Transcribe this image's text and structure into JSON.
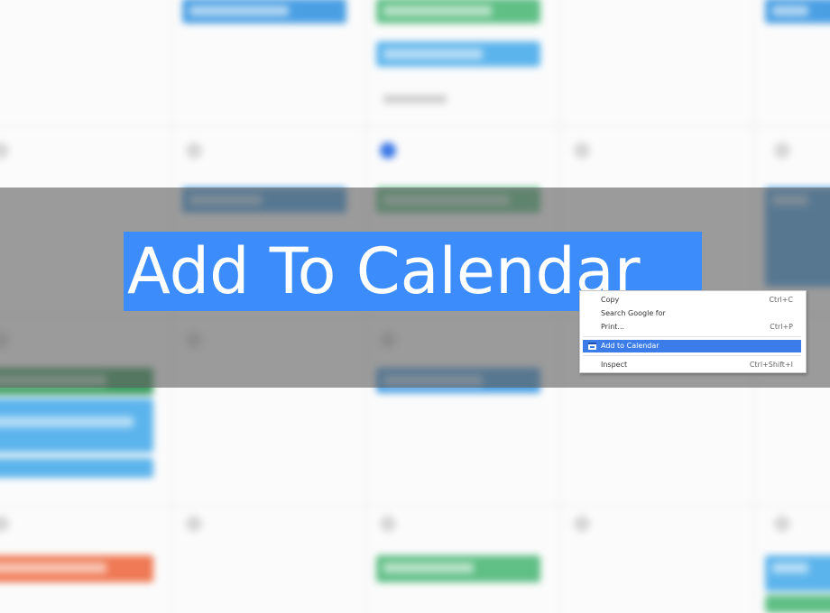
{
  "title": {
    "text": "Add To Calendar",
    "highlight_color": "#3c8dfb"
  },
  "context_menu": {
    "items": [
      {
        "label": "Copy",
        "shortcut": "Ctrl+C"
      },
      {
        "label": "Search Google for",
        "shortcut": ""
      },
      {
        "label": "Print...",
        "shortcut": "Ctrl+P"
      },
      {
        "label": "Add to Calendar",
        "shortcut": "",
        "icon": "calendar-icon",
        "highlighted": true
      },
      {
        "label": "Inspect",
        "shortcut": "Ctrl+Shift+I"
      }
    ],
    "highlight_color": "#3b7ce8"
  },
  "background": {
    "description_colors": {
      "event_blue": "#4a9fe3",
      "event_green": "#5fbf85",
      "event_orange": "#ef7a55",
      "today_marker": "#3b78e7",
      "overlay": "#5f5f5f"
    }
  }
}
